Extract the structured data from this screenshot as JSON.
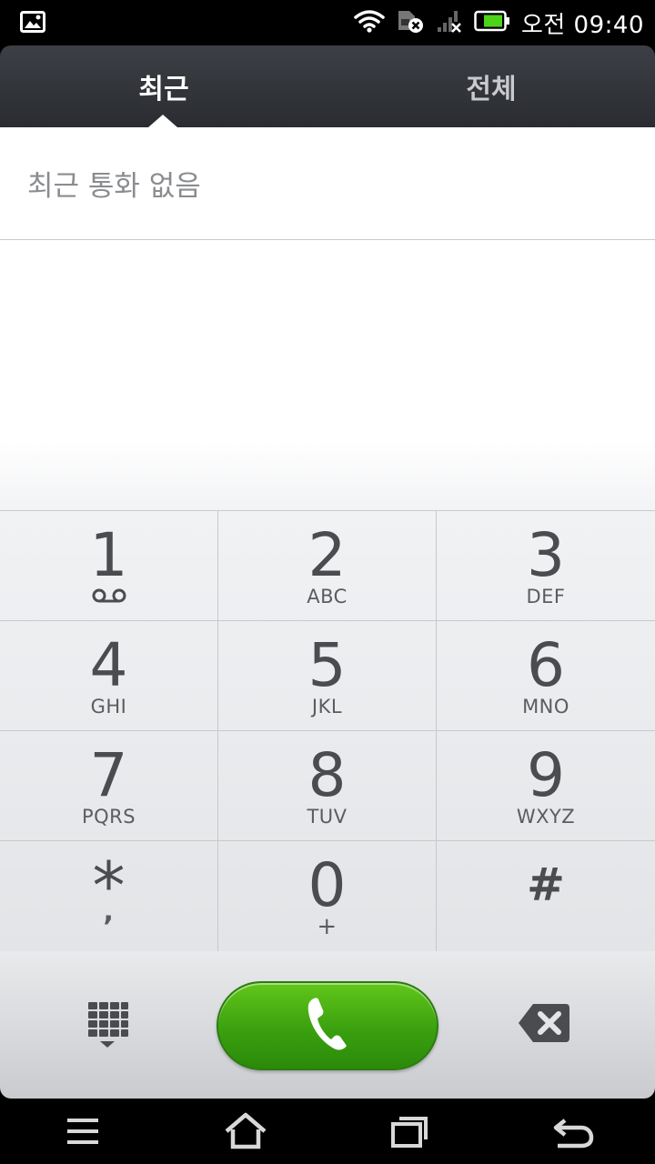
{
  "status_bar": {
    "time": "오전 09:40",
    "icons": [
      "image-notification-icon",
      "wifi-icon",
      "sim-error-icon",
      "signal-no-service-icon",
      "battery-icon"
    ],
    "battery_color": "#4cd31a"
  },
  "tabs": [
    {
      "label": "최근",
      "selected": true
    },
    {
      "label": "전체",
      "selected": false
    }
  ],
  "recent": {
    "empty_message": "최근 통화 없음"
  },
  "dialpad": {
    "keys": [
      {
        "digit": "1",
        "letters": ""
      },
      {
        "digit": "2",
        "letters": "ABC"
      },
      {
        "digit": "3",
        "letters": "DEF"
      },
      {
        "digit": "4",
        "letters": "GHI"
      },
      {
        "digit": "5",
        "letters": "JKL"
      },
      {
        "digit": "6",
        "letters": "MNO"
      },
      {
        "digit": "7",
        "letters": "PQRS"
      },
      {
        "digit": "8",
        "letters": "TUV"
      },
      {
        "digit": "9",
        "letters": "WXYZ"
      },
      {
        "digit": "*",
        "letters": ","
      },
      {
        "digit": "0",
        "letters": "+"
      },
      {
        "digit": "#",
        "letters": ""
      }
    ]
  },
  "actions": {
    "left_icon": "dialpad-toggle-icon",
    "center_icon": "phone-icon",
    "right_icon": "backspace-icon",
    "call_color": "#3aa00f"
  },
  "nav_bar": {
    "buttons": [
      "menu-icon",
      "home-icon",
      "recent-apps-icon",
      "back-icon"
    ]
  }
}
